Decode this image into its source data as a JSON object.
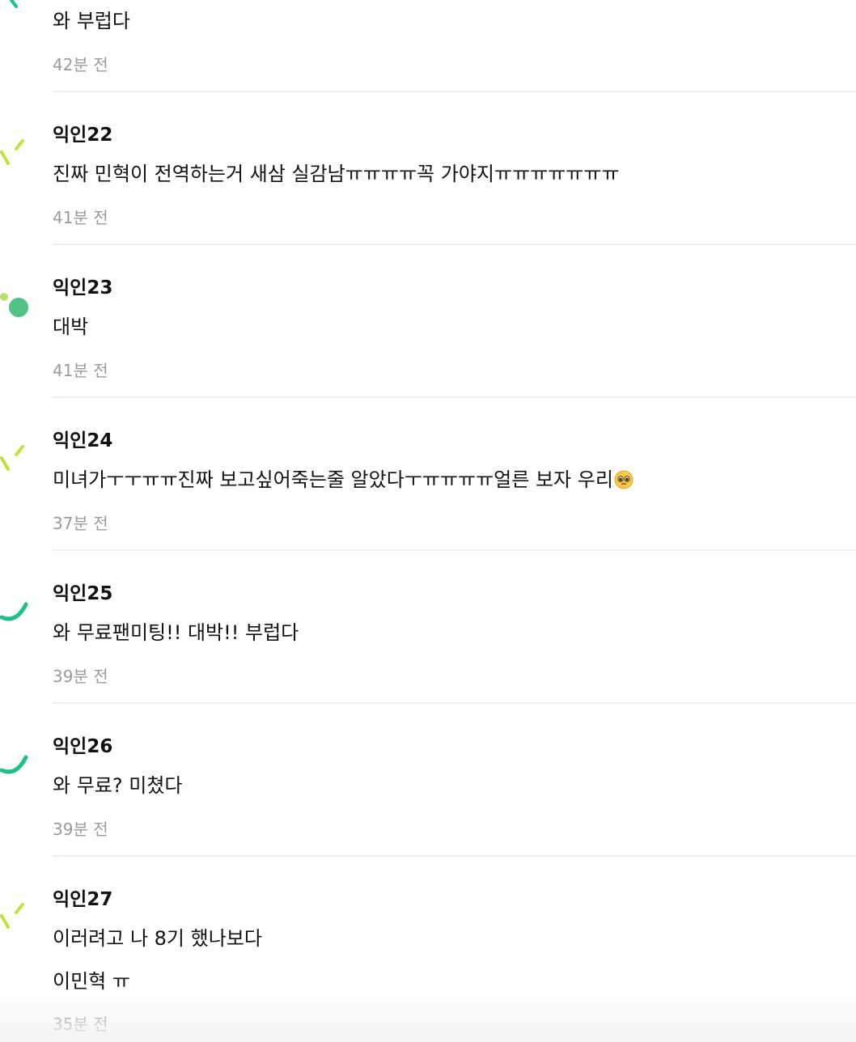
{
  "comments": [
    {
      "author": "",
      "lines": [
        "와 부럽다"
      ],
      "time": "42분 전",
      "avatar_icon": "partial-yellow-dash-avatar-icon"
    },
    {
      "author": "익인22",
      "lines": [
        "진짜 민혁이 전역하는거 새삼 실감남ㅠㅠㅠㅠ꼭 가야지ㅠㅠㅠㅠㅠㅠㅠ"
      ],
      "time": "41분 전",
      "avatar_icon": "dash-pair-avatar-icon"
    },
    {
      "author": "익인23",
      "lines": [
        "대박"
      ],
      "time": "41분 전",
      "avatar_icon": "green-dots-avatar-icon"
    },
    {
      "author": "익인24",
      "lines": [
        "미녀가ㅜㅜㅠㅠ진짜 보고싶어죽는줄 알았다ㅜㅠㅠㅠㅠ얼른 보자 우리"
      ],
      "emoji": "pleading-face-emoji",
      "time": "37분 전",
      "avatar_icon": "dash-pair-avatar-icon"
    },
    {
      "author": "익인25",
      "lines": [
        "와 무료팬미팅!! 대박!! 부럽다"
      ],
      "time": "39분 전",
      "avatar_icon": "green-arc-avatar-icon"
    },
    {
      "author": "익인26",
      "lines": [
        "와 무료? 미쳤다"
      ],
      "time": "39분 전",
      "avatar_icon": "green-arc-avatar-icon"
    },
    {
      "author": "익인27",
      "lines": [
        "이러려고 나 8기 했나보다",
        "이민혁 ㅠ"
      ],
      "time": "35분 전",
      "avatar_icon": "dash-pair-avatar-icon"
    }
  ],
  "colors": {
    "text": "#111111",
    "time": "#9a9a9a",
    "divider": "#eeeeee",
    "avatar_green": "#1fbf85",
    "avatar_lime": "#c8dc3c",
    "avatar_dot_green": "#52c287",
    "avatar_dot_lime": "#b6e36a"
  }
}
